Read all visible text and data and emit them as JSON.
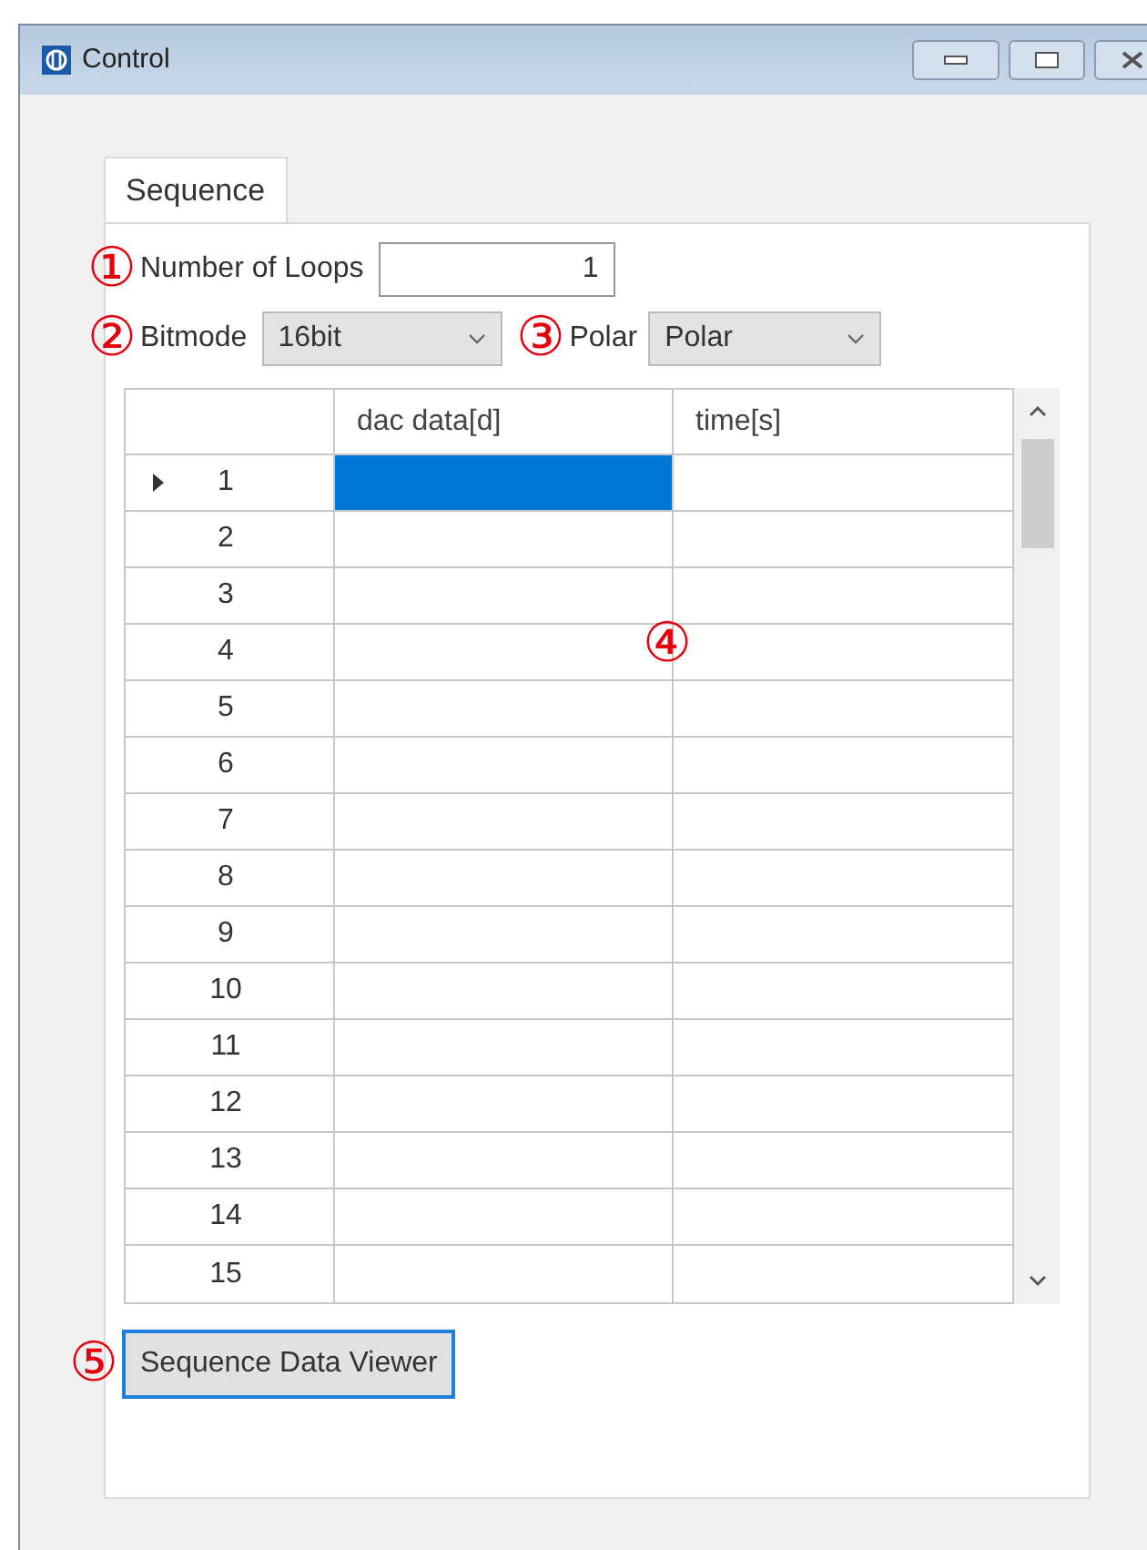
{
  "window": {
    "title": "Control"
  },
  "tabs": [
    {
      "label": "Sequence",
      "selected": true
    }
  ],
  "annotations": [
    "①",
    "②",
    "③",
    "④",
    "⑤"
  ],
  "loops": {
    "label": "Number of Loops",
    "value": "1"
  },
  "bitmode": {
    "label": "Bitmode",
    "value": "16bit"
  },
  "polar": {
    "label": "Polar",
    "value": "Polar"
  },
  "table": {
    "columns": [
      "dac data[d]",
      "time[s]"
    ],
    "rows": [
      {
        "number": "1",
        "selected": true
      },
      {
        "number": "2",
        "selected": false
      },
      {
        "number": "3",
        "selected": false
      },
      {
        "number": "4",
        "selected": false
      },
      {
        "number": "5",
        "selected": false
      },
      {
        "number": "6",
        "selected": false
      },
      {
        "number": "7",
        "selected": false
      },
      {
        "number": "8",
        "selected": false
      },
      {
        "number": "9",
        "selected": false
      },
      {
        "number": "10",
        "selected": false
      },
      {
        "number": "11",
        "selected": false
      },
      {
        "number": "12",
        "selected": false
      },
      {
        "number": "13",
        "selected": false
      },
      {
        "number": "14",
        "selected": false
      },
      {
        "number": "15",
        "selected": false
      }
    ]
  },
  "viewer_button": "Sequence Data Viewer"
}
